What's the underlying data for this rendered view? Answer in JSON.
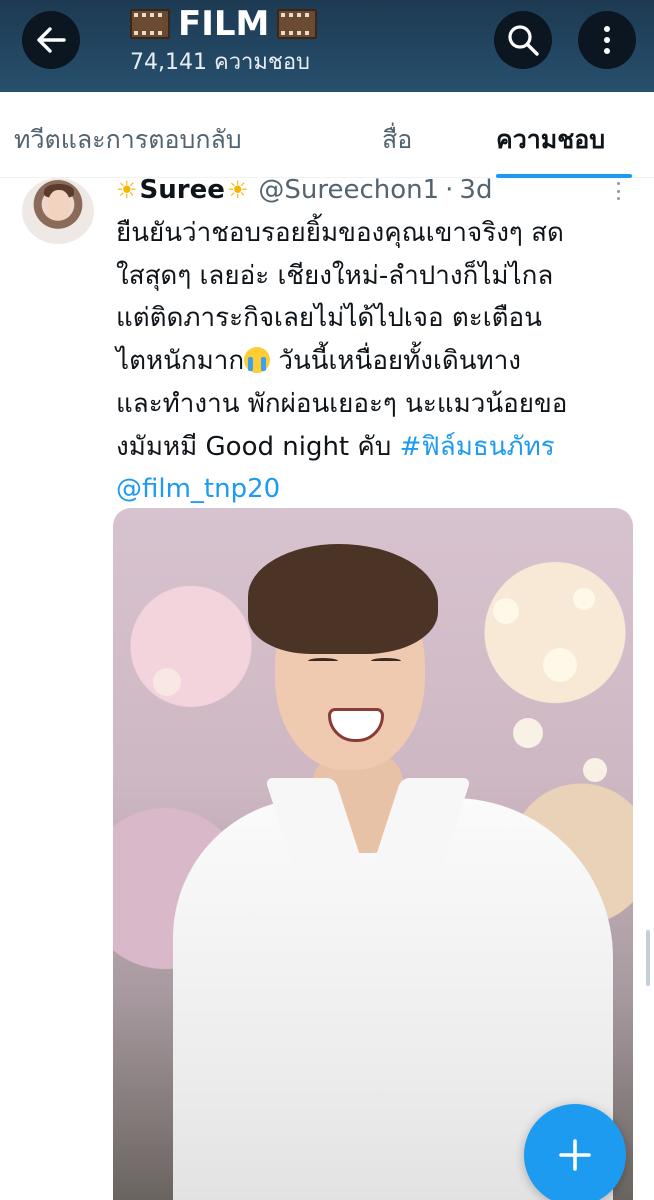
{
  "header": {
    "title": "FILM",
    "subtitle": "74,141 ความชอบ",
    "title_icon": "film-frames-icon"
  },
  "tabs": [
    {
      "label": "ทวีตและการตอบกลับ",
      "active": false
    },
    {
      "label": "สื่อ",
      "active": false
    },
    {
      "label": "ความชอบ",
      "active": true
    }
  ],
  "tweet": {
    "name": "Suree",
    "name_decoration": "☀",
    "handle": "@Sureechon1",
    "separator": "·",
    "time": "3d",
    "lines": [
      "ยืนยันว่าชอบรอยยิ้มของคุณเขาจริงๆ สด",
      "ใสสุดๆ เลยอ่ะ เชียงใหม่-ลำปางก็ไม่ไกล",
      "แต่ติดภาระกิจเลยไม่ได้ไปเจอ ตะเตือน",
      "ไตหนักมาก",
      "วันนี้เหนื่อยทั้งเดินทาง",
      "และทำงาน พักผ่อนเยอะๆ นะแมวน้อยขอ",
      "งมัมหมี Good night คับ ",
      "#ฟิล์มธนภัทร",
      "@film_tnp20"
    ],
    "emoji": "crying-face-emoji"
  },
  "colors": {
    "header_bg": "#1d3a52",
    "accent": "#1d9bf0",
    "text_primary": "#0f1419",
    "text_secondary": "#536471"
  }
}
